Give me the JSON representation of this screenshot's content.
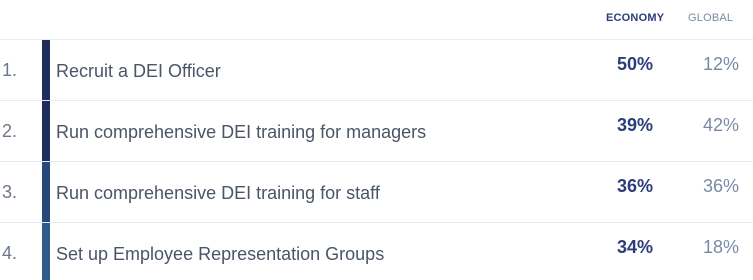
{
  "headers": {
    "economy": "ECONOMY",
    "global": "GLOBAL"
  },
  "colors": {
    "bars": [
      "#1f2d5c",
      "#1f2d5c",
      "#27497a",
      "#2f5a8c"
    ],
    "economy_text": "#2c3e7a",
    "global_text": "#7a8aa6",
    "divider": "#e8ebf0"
  },
  "rows": [
    {
      "rank": "1.",
      "label": "Recruit a DEI Officer",
      "economy": "50%",
      "global": "12%"
    },
    {
      "rank": "2.",
      "label": "Run comprehensive DEI training for managers",
      "economy": "39%",
      "global": "42%"
    },
    {
      "rank": "3.",
      "label": "Run comprehensive DEI training for staff",
      "economy": "36%",
      "global": "36%"
    },
    {
      "rank": "4.",
      "label": "Set up Employee Representation Groups",
      "economy": "34%",
      "global": "18%"
    }
  ]
}
